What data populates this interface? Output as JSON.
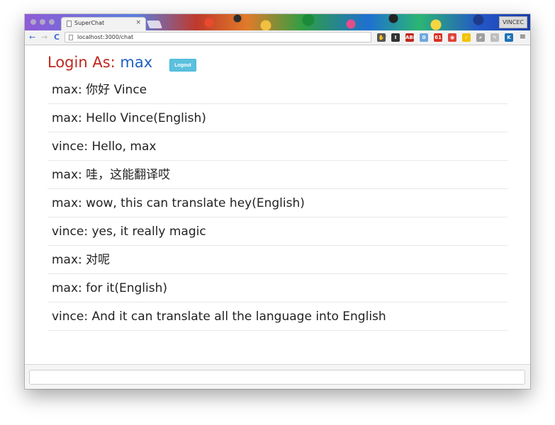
{
  "browser": {
    "tab_title": "SuperChat",
    "tab_close": "×",
    "profile_name": "VINCEC",
    "url": "localhost:3000/chat",
    "nav": {
      "back": "←",
      "forward": "→",
      "reload": "C"
    },
    "bookmark": "☆",
    "extensions": [
      {
        "name": "hand-icon",
        "label": "✋",
        "color": "#555555"
      },
      {
        "name": "instapaper-icon",
        "label": "I",
        "color": "#333333"
      },
      {
        "name": "adblock-icon",
        "label": "ABP",
        "color": "#c0271f"
      },
      {
        "name": "lock-icon",
        "label": "0",
        "color": "#6fa8dc"
      },
      {
        "name": "calendar-icon",
        "label": "61",
        "color": "#d93025"
      },
      {
        "name": "screencast-icon",
        "label": "◉",
        "color": "#e0413a"
      },
      {
        "name": "check-icon",
        "label": "✓",
        "color": "#f2c200"
      },
      {
        "name": "magnifier-icon",
        "label": "⌕",
        "color": "#9e9e9e"
      },
      {
        "name": "feather-icon",
        "label": "✎",
        "color": "#bdbdbd"
      },
      {
        "name": "k-icon",
        "label": "K",
        "color": "#1f73b7"
      }
    ],
    "menu": "≡"
  },
  "header": {
    "login_prefix": "Login As:",
    "username": "max",
    "logout_label": "Logout"
  },
  "messages": [
    {
      "text": "max: 你好 Vince"
    },
    {
      "text": "max: Hello Vince(English)"
    },
    {
      "text": "vince: Hello, max"
    },
    {
      "text": "max: 哇，这能翻译哎"
    },
    {
      "text": "max: wow, this can translate hey(English)"
    },
    {
      "text": "vince: yes, it really magic"
    },
    {
      "text": "max: 对呢"
    },
    {
      "text": "max: for it(English)"
    },
    {
      "text": "vince: And it can translate all the language into English"
    }
  ],
  "composer": {
    "value": "",
    "placeholder": ""
  },
  "colors": {
    "login_label": "#c0271f",
    "username": "#1e5fc4",
    "logout_button": "#5bc0de"
  }
}
